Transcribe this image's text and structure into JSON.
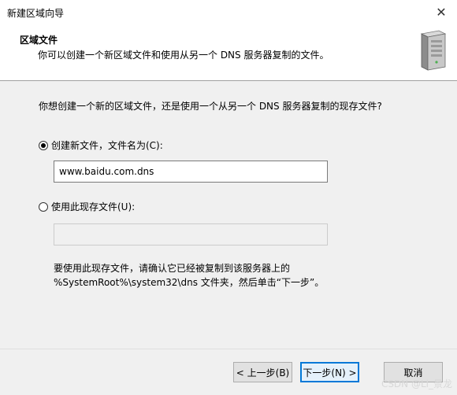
{
  "window": {
    "title": "新建区域向导"
  },
  "header": {
    "title": "区域文件",
    "description": "你可以创建一个新区域文件和使用从另一个 DNS 服务器复制的文件。",
    "icon": "server-icon"
  },
  "main": {
    "question": "你想创建一个新的区域文件，还是使用一个从另一个 DNS 服务器复制的现存文件?",
    "option_new": {
      "label": "创建新文件，文件名为(C):",
      "checked": true,
      "value": "www.baidu.com.dns"
    },
    "option_existing": {
      "label": "使用此现存文件(U):",
      "checked": false,
      "value": ""
    },
    "note_line1": "要使用此现存文件，请确认它已经被复制到该服务器上的",
    "note_line2": "%SystemRoot%\\system32\\dns 文件夹，然后单击“下一步”。"
  },
  "footer": {
    "back_label": "< 上一步(B)",
    "next_label": "下一步(N) >",
    "cancel_label": "取消"
  },
  "watermark": "CSDN @Li_景龙"
}
